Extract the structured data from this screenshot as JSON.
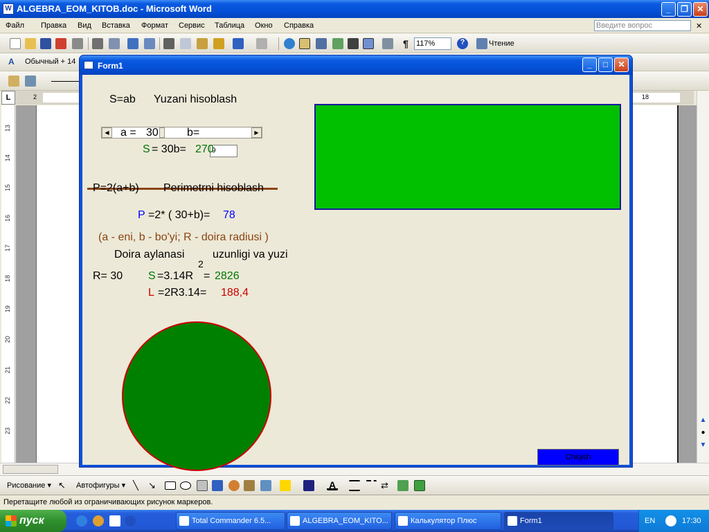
{
  "word": {
    "title": "ALGEBRA_EOM_KITOB.doc - Microsoft Word",
    "menu": [
      "Файл",
      "Правка",
      "Вид",
      "Вставка",
      "Формат",
      "Сервис",
      "Таблица",
      "Окно",
      "Справка"
    ],
    "ask_placeholder": "Введите вопрос",
    "zoom": "117%",
    "reading_label": "Чтение",
    "style_value": "Обычный + 14",
    "status_text": "Перетащите любой из ограничивающих рисунок маркеров.",
    "draw_label": "Рисование",
    "autoshapes_label": "Автофигуры",
    "ruler_left_numbers": [
      "13",
      "14",
      "15",
      "16",
      "17",
      "18",
      "19",
      "20",
      "21",
      "22",
      "23"
    ],
    "ruler_top_numbers": [
      "2",
      "18"
    ]
  },
  "form": {
    "title": "Form1",
    "area_formula": "S=ab",
    "area_title": "Yuzani hisoblash",
    "a_label": "a =",
    "a_value": "30",
    "b_label": "b=",
    "b_input": "9",
    "s_label": "S",
    "s_expr": "= 30b=",
    "s_result": "270",
    "perim_formula": "P=2(a+b)",
    "perim_title": "Perimetrni hisoblash",
    "p_label": "P",
    "p_expr": "=2* ( 30+b)=",
    "p_result": "78",
    "legend": "(a - eni, b - bo'yi; R - doira radiusi )",
    "circle_title": "Doira aylanasi",
    "circle_title2": "uzunligi va  yuzi",
    "superscript": "2",
    "r_text": "R= 30",
    "cs_label": "S",
    "cs_expr": "=3.14R",
    "cs_eq": "=",
    "cs_result": "2826",
    "l_label": "L",
    "l_expr": "=2R3.14=",
    "l_result": "188,4",
    "exit_button": "Chiqish",
    "scroll_fraction": 0.35
  },
  "taskbar": {
    "start": "пуск",
    "tasks": [
      "Total Commander 6.5...",
      "ALGEBRA_EOM_KITO...",
      "Калькулятор Плюс",
      "Form1"
    ],
    "lang": "EN",
    "clock": "17:30"
  },
  "colors": {
    "green_rect": "#00c000",
    "circle_fill": "#008000",
    "circle_border": "#cc0000",
    "exit_button": "#0000ff"
  }
}
